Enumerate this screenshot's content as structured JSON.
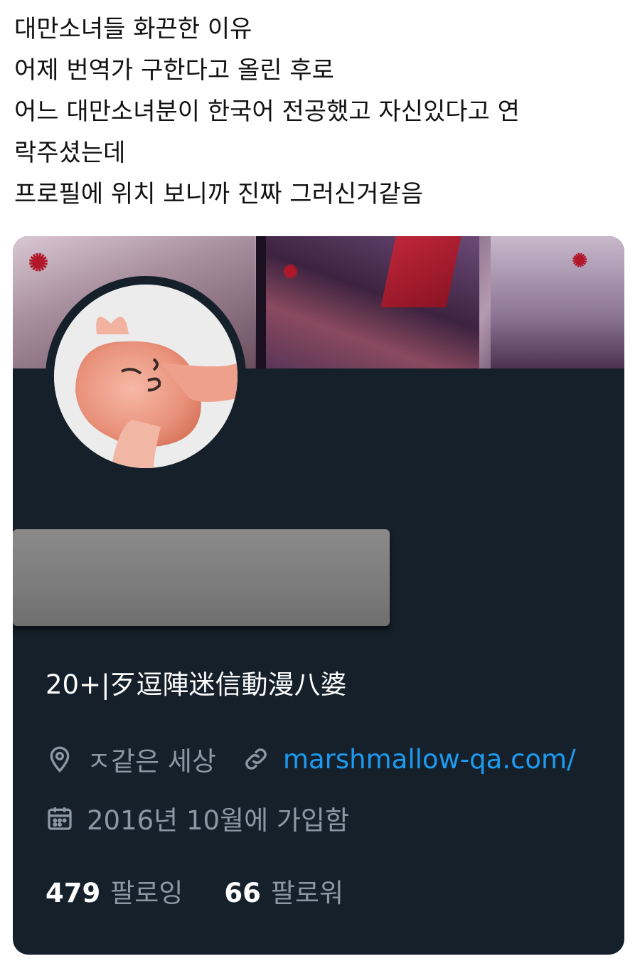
{
  "post": {
    "lines": [
      "대만소녀들 화끈한 이유",
      "어제 번역가 구한다고 올린 후로",
      "어느 대만소녀분이 한국어 전공했고 자신있다고 연",
      "락주셨는데",
      "프로필에 위치 보니까 진짜 그러신거같음"
    ]
  },
  "profile": {
    "bio": "20+|歹逗陣迷信動漫八婆",
    "location": "ㅈ같은 세상",
    "website": "marshmallow-qa.com/",
    "joined": "2016년 10월에 가입함",
    "following_count": "479",
    "following_label": "팔로잉",
    "followers_count": "66",
    "followers_label": "팔로워"
  },
  "icons": {
    "location": "location-pin-icon",
    "link": "link-icon",
    "calendar": "calendar-icon"
  },
  "colors": {
    "card_bg": "#15202b",
    "muted": "#8b98a5",
    "link": "#1d9bf0",
    "redaction": "#7b7b7b"
  }
}
